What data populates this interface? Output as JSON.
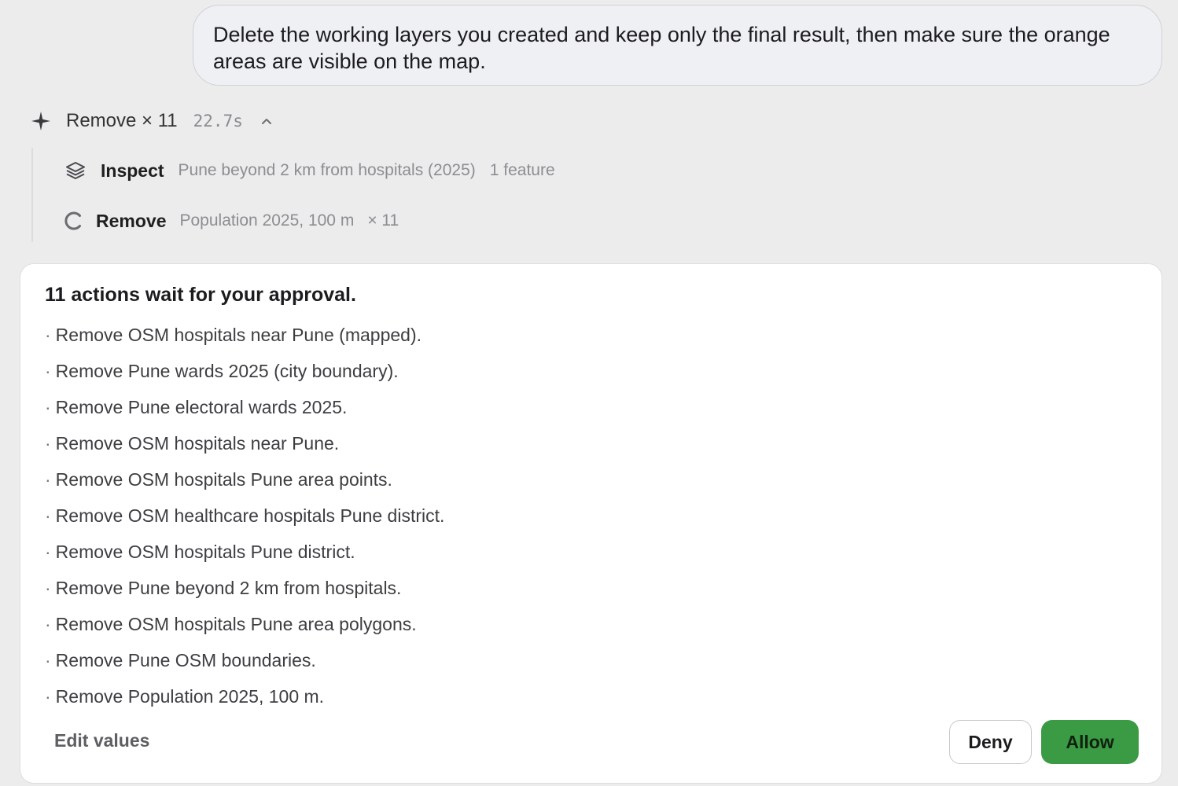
{
  "user_message": "Delete the working layers you created and keep only the final result, then make sure the orange areas are visible on the map.",
  "step": {
    "title": "Remove × 11",
    "duration": "22.7s",
    "icon": "sparkle-icon",
    "expanded": true,
    "substeps": [
      {
        "icon": "layers-icon",
        "label": "Inspect",
        "detail": "Pune beyond 2 km from hospitals (2025)",
        "extra": "1 feature"
      },
      {
        "icon": "spinner-icon",
        "label": "Remove",
        "detail": "Population 2025, 100 m",
        "extra": "× 11"
      }
    ]
  },
  "approval": {
    "title": "11 actions wait for your approval.",
    "actions": [
      "Remove OSM hospitals near Pune (mapped).",
      "Remove Pune wards 2025 (city boundary).",
      "Remove Pune electoral wards 2025.",
      "Remove OSM hospitals near Pune.",
      "Remove OSM hospitals Pune area points.",
      "Remove OSM healthcare hospitals Pune district.",
      "Remove OSM hospitals Pune district.",
      "Remove Pune beyond 2 km from hospitals.",
      "Remove OSM hospitals Pune area polygons.",
      "Remove Pune OSM boundaries.",
      "Remove Population 2025, 100 m."
    ],
    "edit_label": "Edit values",
    "deny_label": "Deny",
    "allow_label": "Allow",
    "allow_color": "#3b9a44"
  }
}
